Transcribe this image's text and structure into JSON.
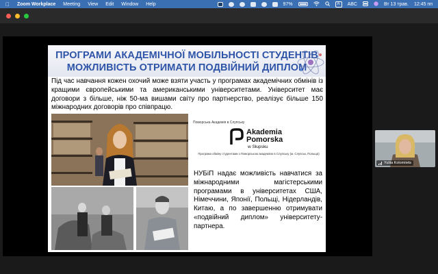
{
  "menubar": {
    "app_name": "Zoom Workplace",
    "menus": [
      "Meeting",
      "View",
      "Edit",
      "Window",
      "Help"
    ],
    "battery_percent": "97%",
    "battery_level": 0.97,
    "keyboard_layout": "A",
    "input_source": "ABC",
    "date": "Вт 13 трав.",
    "time": "12:45 пп"
  },
  "slide": {
    "title_line1": "ПРОГРАМИ АКАДЕМІЧНОЇ МОБІЛЬНОСТІ СТУДЕНТІВ",
    "title_line2": "МОЖЛИВІСТЬ ОТРИМАТИ ПОДВІЙНИЙ ДИПЛОМ",
    "intro": "Під час навчання кожен охочий може взяти участь у програмах академічних обмінів із кращими європейськими та американськими університетами. Університет має договори з більше, ніж 50-ма вишами світу про партнерство, реалізує більше 150 міжнародних договорів про співпрацю.",
    "partner_caption": "Поморська Академія в Слупську",
    "partner_name_line1": "Akademia",
    "partner_name_line2": "Pomorska",
    "partner_city": "w Słupsku",
    "program_caption": "Програма обміну студентами з Поморською академією в Слупську (м. Слупськ, Польща)",
    "lower_text": "НУБіП надає можливість навчатися за міжнародними магістерськими програмами в університетах США, Німеччини, Японії, Польщі, Нідерландів, Китаю, а по завершенню отримувати «подвійний диплом» університету-партнера."
  },
  "participant": {
    "name": "Yuliia Kolomiiets"
  },
  "colors": {
    "menubar_bg": "#3b6fb3",
    "slide_title": "#2e54a8",
    "traffic_red": "#ff5f57",
    "traffic_yellow": "#febc2e",
    "traffic_green": "#28c840"
  }
}
